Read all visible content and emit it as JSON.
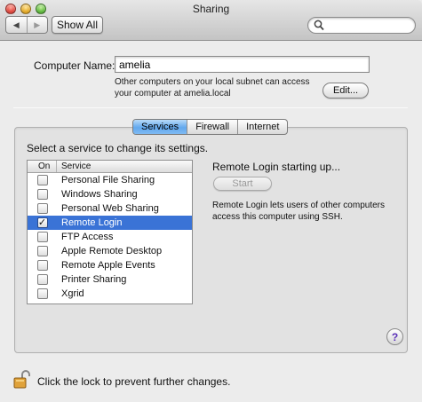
{
  "window": {
    "title": "Sharing"
  },
  "toolbar": {
    "back_icon": "◀",
    "forward_icon": "▶",
    "show_all_label": "Show All",
    "search_placeholder": ""
  },
  "computer": {
    "label": "Computer Name:",
    "name": "amelia",
    "description": "Other computers on your local subnet can access your computer at amelia.local",
    "edit_label": "Edit..."
  },
  "tabs": [
    {
      "label": "Services",
      "active": true
    },
    {
      "label": "Firewall",
      "active": false
    },
    {
      "label": "Internet",
      "active": false
    }
  ],
  "services": {
    "prompt": "Select a service to change its settings.",
    "header_on": "On",
    "header_service": "Service",
    "items": [
      {
        "name": "Personal File Sharing",
        "checked": false
      },
      {
        "name": "Windows Sharing",
        "checked": false
      },
      {
        "name": "Personal Web Sharing",
        "checked": false
      },
      {
        "name": "Remote Login",
        "checked": true,
        "selected": true
      },
      {
        "name": "FTP Access",
        "checked": false
      },
      {
        "name": "Apple Remote Desktop",
        "checked": false
      },
      {
        "name": "Remote Apple Events",
        "checked": false
      },
      {
        "name": "Printer Sharing",
        "checked": false
      },
      {
        "name": "Xgrid",
        "checked": false
      }
    ]
  },
  "detail": {
    "status": "Remote Login starting up...",
    "button_label": "Start",
    "description": "Remote Login lets users of other computers access this computer using SSH."
  },
  "help": {
    "label": "?"
  },
  "lock": {
    "text": "Click the lock to prevent further changes."
  },
  "colors": {
    "selection": "#3a73d6",
    "tab_active": "#62a8ee"
  }
}
